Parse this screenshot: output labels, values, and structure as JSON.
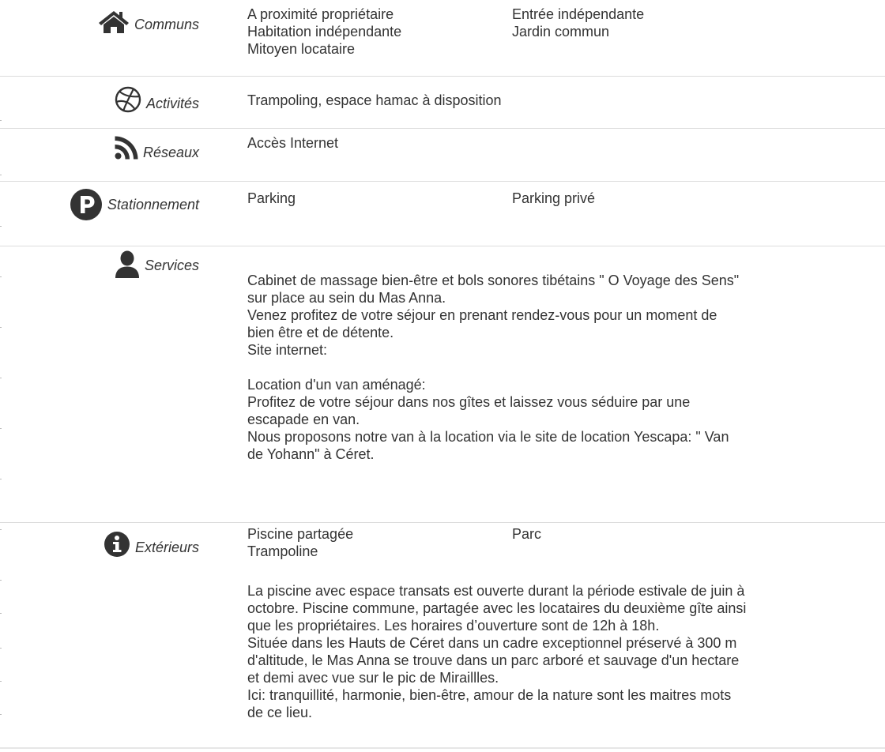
{
  "communs": {
    "label": "Communs",
    "icon": "home-icon",
    "items_col1": [
      "A proximité propriétaire",
      "Habitation indépendante",
      "Mitoyen locataire"
    ],
    "items_col2": [
      "Entrée indépendante",
      "Jardin commun"
    ]
  },
  "activites": {
    "label": "Activités",
    "icon": "dribbble-ball-icon",
    "text": "Trampoling, espace hamac à disposition"
  },
  "reseaux": {
    "label": "Réseaux",
    "icon": "rss-icon",
    "text": "Accès Internet"
  },
  "stationnement": {
    "label": "Stationnement",
    "icon": "parking-icon",
    "items_col1": [
      "Parking"
    ],
    "items_col2": [
      "Parking privé"
    ]
  },
  "services": {
    "label": "Services",
    "icon": "user-icon",
    "text": "Cabinet de massage bien-être et bols sonores tibétains \" O Voyage des Sens\"\nsur place au sein du Mas Anna.\nVenez profitez de votre séjour en prenant rendez-vous pour un moment de\nbien être et de détente.\nSite internet:\n\nLocation d'un van aménagé:\nProfitez de votre séjour dans nos gîtes et laissez vous séduire par une\nescapade en van.\nNous proposons notre van à la location via le site de location Yescapa: \" Van\nde Yohann\" à Céret."
  },
  "exterieurs": {
    "label": "Extérieurs",
    "icon": "info-icon",
    "items_col1": [
      "Piscine partagée",
      "Trampoline"
    ],
    "items_col2": [
      "Parc"
    ],
    "text": "La piscine avec espace transats est ouverte durant la période estivale de juin à\noctobre. Piscine commune, partagée avec les locataires du deuxième gîte ainsi\nque les propriétaires. Les horaires d’ouverture sont de 12h à 18h.\nSituée dans les Hauts de Céret dans un cadre exceptionnel préservé à 300 m\nd'altitude, le Mas Anna se trouve dans un parc arboré et sauvage d'un hectare\net demi avec vue sur le pic de Miraillles.\nIci: tranquillité, harmonie, bien-être, amour de la nature sont les maitres mots\nde ce lieu."
  }
}
